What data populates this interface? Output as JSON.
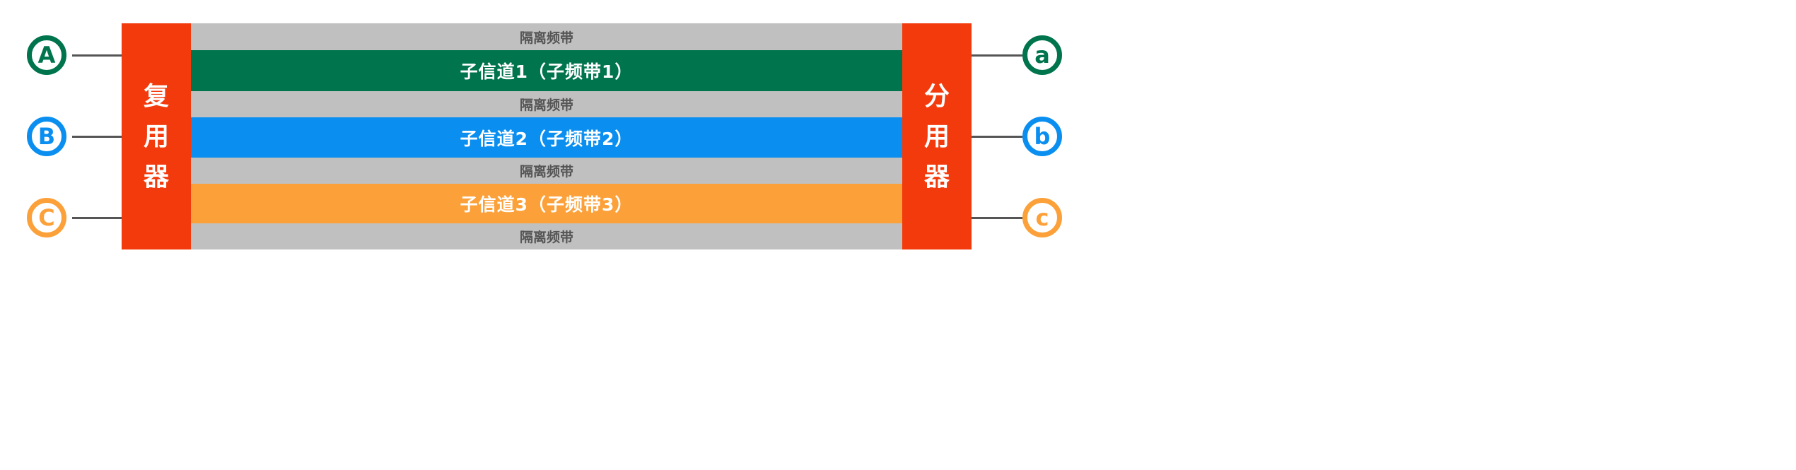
{
  "multiplexer": {
    "label_chars": [
      "复",
      "用",
      "器"
    ],
    "color": "#f23a0c"
  },
  "demultiplexer": {
    "label_chars": [
      "分",
      "用",
      "器"
    ],
    "color": "#f23a0c"
  },
  "guard_band": {
    "label": "隔离频带",
    "color": "#c0c0c0"
  },
  "channels": [
    {
      "label": "子信道1（子频带1）",
      "color": "#00744c"
    },
    {
      "label": "子信道2（子频带2）",
      "color": "#0a8ff0"
    },
    {
      "label": "子信道3（子频带3）",
      "color": "#fca13a"
    }
  ],
  "inputs": [
    {
      "label": "A",
      "color": "#00744c"
    },
    {
      "label": "B",
      "color": "#0a8ff0"
    },
    {
      "label": "C",
      "color": "#fca13a"
    }
  ],
  "outputs": [
    {
      "label": "a",
      "color": "#00744c"
    },
    {
      "label": "b",
      "color": "#0a8ff0"
    },
    {
      "label": "c",
      "color": "#fca13a"
    }
  ]
}
